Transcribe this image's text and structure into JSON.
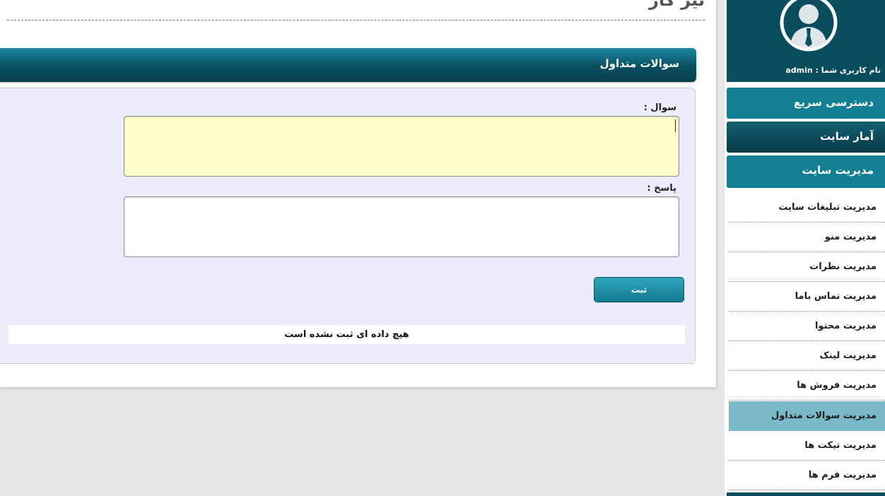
{
  "page": {
    "title": "تیر کار"
  },
  "section": {
    "header": "سوالات متداول"
  },
  "form": {
    "question_label": "سوال :",
    "answer_label": "پاسخ :",
    "question_value": "",
    "answer_value": "",
    "submit_label": "ثبت"
  },
  "table": {
    "empty_message": "هیچ داده ای ثبت نشده است"
  },
  "sidebar": {
    "username_label": "نام کاربری شما : admin",
    "buttons": [
      {
        "label": "دسترسی سریع"
      },
      {
        "label": "آمار سایت"
      },
      {
        "label": "مدیریت سایت"
      }
    ],
    "items": [
      {
        "label": "مدیریت تبلیغات سایت"
      },
      {
        "label": "مدیریت منو"
      },
      {
        "label": "مدیریت نظرات"
      },
      {
        "label": "مدیریت تماس باما"
      },
      {
        "label": "مدیریت محتوا"
      },
      {
        "label": "مدیریت لینک"
      },
      {
        "label": "مدیریت فروش ها"
      },
      {
        "label": "مدیریت سوالات متداول"
      },
      {
        "label": "مدیریت تیکت ها"
      },
      {
        "label": "مدیریت فرم ها"
      }
    ]
  },
  "colors": {
    "accent": "#137f92",
    "dark_accent": "#0a4e5e",
    "active_item": "#7ab9c7",
    "question_bg": "#ffffcd"
  }
}
